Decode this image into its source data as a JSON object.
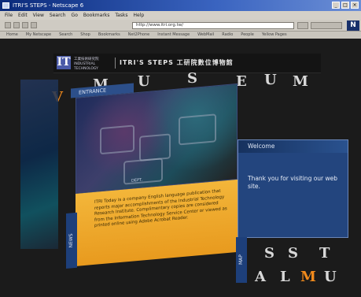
{
  "window": {
    "title": "ITRI'S STEPS - Netscape 6",
    "buttons": [
      "_",
      "□",
      "×"
    ]
  },
  "menu": [
    "File",
    "Edit",
    "View",
    "Search",
    "Go",
    "Bookmarks",
    "Tasks",
    "Help"
  ],
  "urlbar": {
    "url": "http://www.itri.org.tw/",
    "brand": "N"
  },
  "bookmarks": [
    "Home",
    "My Netscape",
    "Search",
    "Shop",
    "Bookmarks",
    "Net2Phone",
    "Instant Message",
    "WebMail",
    "Radio",
    "People",
    "Yellow Pages"
  ],
  "site": {
    "logo_mark": "IT",
    "logo_text": "工業技術研究院 INDUSTRIAL TECHNOLOGY",
    "title": "ITRI'S STEPS  工研院數位博物館"
  },
  "background_letters": {
    "top": [
      "M",
      "U",
      "S",
      "E",
      "U",
      "M"
    ],
    "top_left": "V",
    "bottom_row1": [
      "'",
      "S",
      "S",
      "T"
    ],
    "bottom_row2": [
      "A",
      "L",
      "M",
      "U"
    ]
  },
  "entrance": {
    "tab_label": "ENTRANCE",
    "image_caption": "DEPT.",
    "info_text": "ITRI Today is a company English language publication that reports major accomplishments of the Industrial Technology Research Institute. Complimentary copies are considered from the Information Technology Service Center or viewed as printed online using Adobe Acrobat Reader.",
    "news_tab": "NEWS"
  },
  "welcome": {
    "header": "Welcome",
    "text": "Thank you for visiting our web site."
  },
  "map_tab": "MAP",
  "colors": {
    "accent_orange": "#f08a1c",
    "panel_blue": "#23457e",
    "info_gold": "#f3b63a"
  }
}
